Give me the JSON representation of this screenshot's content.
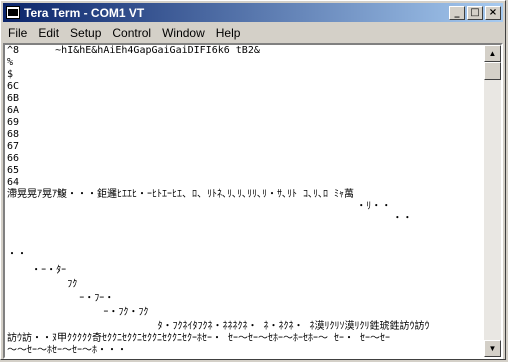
{
  "window": {
    "title": "Tera Term - COM1 VT"
  },
  "title_buttons": {
    "minimize": "_",
    "maximize": "□",
    "close": "×"
  },
  "menu": [
    "File",
    "Edit",
    "Setup",
    "Control",
    "Window",
    "Help"
  ],
  "terminal": {
    "lines": [
      "^8      ~hI&hE&hAiEh4GapGaiGaiDIFI6k6 tB2&",
      "%",
      "$",
      "6C",
      "6B",
      "6A",
      "69",
      "68",
      "67",
      "66",
      "65",
      "64",
      "滯晃晃ｱ晃ｱ鰒・・・鉅邏ﾋｴｴﾋ・ｰﾋﾄｴｰﾋｴ、ﾛ、ﾘﾄﾈ､ﾘ､ﾘ､ﾘﾘ､ﾘ・ｻ､ﾘﾄ ｺ､ﾘ､ﾛ ﾐｬ萬",
      "                                                          ・ﾘ・・",
      "                                                                ・・",
      "",
      "・・",
      "    ・ｰ・ﾀｰ",
      "          ﾌｸ",
      "            ｰ・ﾌｰ・",
      "                ｰ・ﾌｸ・ﾌｸ",
      "                         ﾀ・ﾌｸﾈｲﾀﾌｸﾈ・ﾈﾈﾈｸﾈ・ ﾈ・ﾈｸﾈ・ ﾈ漠ﾘｸﾘｿ漠ﾘｸﾘ鉎琥鉎訪ｳ訪ｳ",
      "訪ｳ訪・・ﾇ甲ｸｸｸｸｸ奇ｾｸｸﾆｾｸｸﾆｾｸｸﾆｾｸｸﾆｾｸｰﾎｾｰ・ ｾｰ～ｾｰ～ｾﾎｰ～ﾎｰｾﾎｰ～ ｾｰ・ ｾｰ～ｾｰ",
      "～～ｾｰ～ﾎｾｰ～ｾｰ～ﾎ・・・"
    ]
  }
}
